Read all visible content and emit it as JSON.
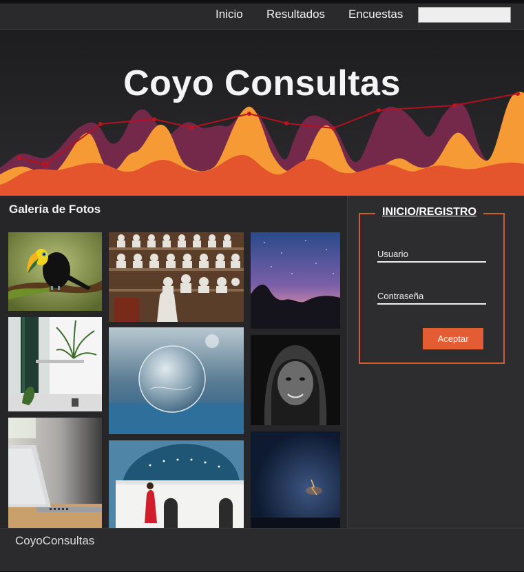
{
  "nav": {
    "links": [
      "Inicio",
      "Resultados",
      "Encuestas"
    ],
    "search_value": ""
  },
  "hero": {
    "title": "Coyo Consultas"
  },
  "gallery": {
    "title": "Galería de Fotos",
    "photos": [
      "toucan-photo",
      "plant-interior-photo",
      "laptop-desk-photo",
      "busts-shelf-photo",
      "frozen-bubble-photo",
      "greek-dome-photo",
      "starry-rocks-photo",
      "hooded-man-portrait-photo",
      "lightning-night-photo"
    ]
  },
  "login": {
    "legend": "INICIO/REGISTRO",
    "username_label": "Usuario",
    "password_label": "Contraseña",
    "submit_label": "Aceptar"
  },
  "footer": {
    "text": "CoyoConsultas"
  },
  "colors": {
    "accent": "#e45c34",
    "orange": "#f59a35",
    "plum": "#7a2a4b",
    "background": "#1b1b1d"
  }
}
